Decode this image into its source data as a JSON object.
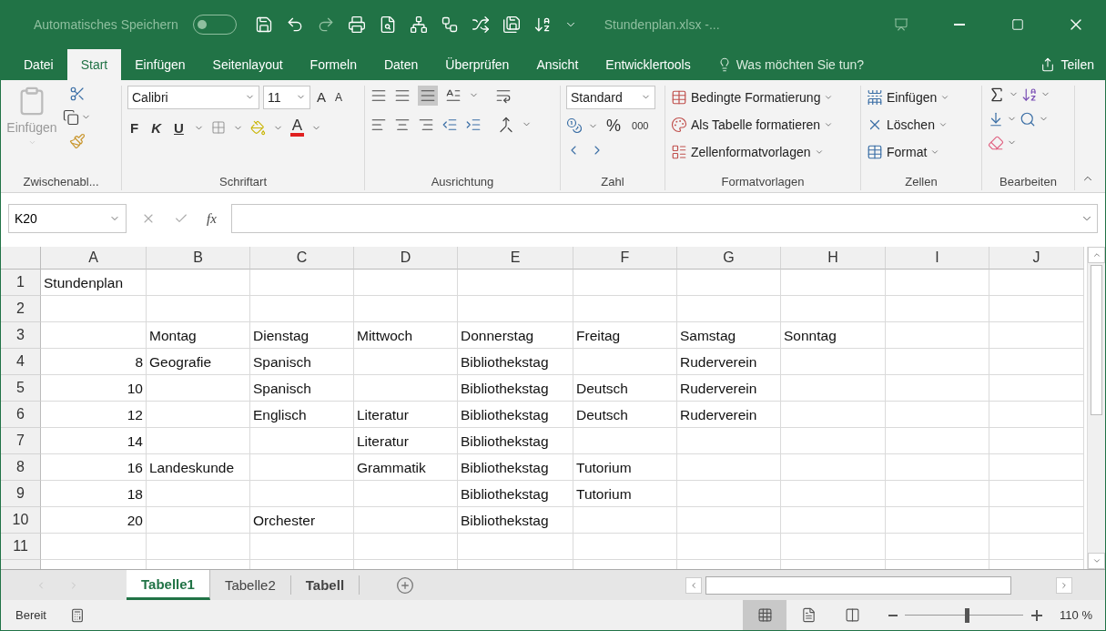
{
  "title_bar": {
    "autosave_label": "Automatisches Speichern",
    "autosave_on": false,
    "file_title": "Stundenplan.xlsx  -..."
  },
  "ribbon_tabs": [
    {
      "label": "Datei",
      "selected": false
    },
    {
      "label": "Start",
      "selected": true
    },
    {
      "label": "Einfügen",
      "selected": false
    },
    {
      "label": "Seitenlayout",
      "selected": false
    },
    {
      "label": "Formeln",
      "selected": false
    },
    {
      "label": "Daten",
      "selected": false
    },
    {
      "label": "Überprüfen",
      "selected": false
    },
    {
      "label": "Ansicht",
      "selected": false
    },
    {
      "label": "Entwicklertools",
      "selected": false
    }
  ],
  "tell_me": "Was möchten Sie tun?",
  "share": "Teilen",
  "ribbon": {
    "clipboard": {
      "paste": "Einfügen",
      "label": "Zwischenabl..."
    },
    "font": {
      "name": "Calibri",
      "size": "11",
      "bold": "F",
      "italic": "K",
      "underline": "U",
      "grow": "A",
      "shrink": "A",
      "color_letter": "A",
      "label": "Schriftart"
    },
    "alignment": {
      "label": "Ausrichtung"
    },
    "number": {
      "format": "Standard",
      "percent": "%",
      "thousands": "000",
      "label": "Zahl"
    },
    "styles": {
      "items": [
        "Bedingte Formatierung",
        "Als Tabelle formatieren",
        "Zellenformatvorlagen"
      ],
      "label": "Formatvorlagen"
    },
    "cells": {
      "items": [
        "Einfügen",
        "Löschen",
        "Format"
      ],
      "label": "Zellen"
    },
    "editing": {
      "label": "Bearbeiten"
    }
  },
  "formula_bar": {
    "name_box": "K20",
    "function_label": "fx"
  },
  "columns": [
    "A",
    "B",
    "C",
    "D",
    "E",
    "F",
    "G",
    "H",
    "I",
    "J"
  ],
  "rows": [
    {
      "number": "1",
      "cells": [
        {
          "text": "Stundenplan",
          "kind": "text"
        },
        null,
        null,
        null,
        null,
        null,
        null,
        null,
        null,
        null
      ]
    },
    {
      "number": "2",
      "cells": [
        null,
        null,
        null,
        null,
        null,
        null,
        null,
        null,
        null,
        null
      ]
    },
    {
      "number": "3",
      "cells": [
        null,
        {
          "text": "Montag",
          "kind": "text"
        },
        {
          "text": "Dienstag",
          "kind": "text"
        },
        {
          "text": "Mittwoch",
          "kind": "text"
        },
        {
          "text": "Donnerstag",
          "kind": "text"
        },
        {
          "text": "Freitag",
          "kind": "text"
        },
        {
          "text": "Samstag",
          "kind": "text"
        },
        {
          "text": "Sonntag",
          "kind": "text"
        },
        null,
        null
      ]
    },
    {
      "number": "4",
      "cells": [
        {
          "text": "8",
          "kind": "number"
        },
        {
          "text": "Geografie",
          "kind": "text"
        },
        {
          "text": "Spanisch",
          "kind": "text"
        },
        null,
        {
          "text": "Bibliothekstag",
          "kind": "text"
        },
        null,
        {
          "text": "Ruderverein",
          "kind": "text"
        },
        null,
        null,
        null
      ]
    },
    {
      "number": "5",
      "cells": [
        {
          "text": "10",
          "kind": "number"
        },
        null,
        {
          "text": "Spanisch",
          "kind": "text"
        },
        null,
        {
          "text": "Bibliothekstag",
          "kind": "text"
        },
        {
          "text": "Deutsch",
          "kind": "text"
        },
        {
          "text": "Ruderverein",
          "kind": "text"
        },
        null,
        null,
        null
      ]
    },
    {
      "number": "6",
      "cells": [
        {
          "text": "12",
          "kind": "number"
        },
        null,
        {
          "text": "Englisch",
          "kind": "text"
        },
        {
          "text": "Literatur",
          "kind": "text"
        },
        {
          "text": "Bibliothekstag",
          "kind": "text"
        },
        {
          "text": "Deutsch",
          "kind": "text"
        },
        {
          "text": "Ruderverein",
          "kind": "text"
        },
        null,
        null,
        null
      ]
    },
    {
      "number": "7",
      "cells": [
        {
          "text": "14",
          "kind": "number"
        },
        null,
        null,
        {
          "text": "Literatur",
          "kind": "text"
        },
        {
          "text": "Bibliothekstag",
          "kind": "text"
        },
        null,
        null,
        null,
        null,
        null
      ]
    },
    {
      "number": "8",
      "cells": [
        {
          "text": "16",
          "kind": "number"
        },
        {
          "text": "Landeskunde",
          "kind": "text"
        },
        null,
        {
          "text": "Grammatik",
          "kind": "text"
        },
        {
          "text": "Bibliothekstag",
          "kind": "text"
        },
        {
          "text": "Tutorium",
          "kind": "text"
        },
        null,
        null,
        null,
        null
      ]
    },
    {
      "number": "9",
      "cells": [
        {
          "text": "18",
          "kind": "number"
        },
        null,
        null,
        null,
        {
          "text": "Bibliothekstag",
          "kind": "text"
        },
        {
          "text": "Tutorium",
          "kind": "text"
        },
        null,
        null,
        null,
        null
      ]
    },
    {
      "number": "10",
      "cells": [
        {
          "text": "20",
          "kind": "number"
        },
        null,
        {
          "text": "Orchester",
          "kind": "text"
        },
        null,
        {
          "text": "Bibliothekstag",
          "kind": "text"
        },
        null,
        null,
        null,
        null,
        null
      ]
    },
    {
      "number": "11",
      "cells": [
        null,
        null,
        null,
        null,
        null,
        null,
        null,
        null,
        null,
        null
      ]
    }
  ],
  "sheet_tabs": [
    {
      "label": "Tabelle1",
      "selected": true,
      "bold": true
    },
    {
      "label": "Tabelle2",
      "selected": false,
      "bold": false
    },
    {
      "label": "Tabell",
      "selected": false,
      "bold": true
    }
  ],
  "status_bar": {
    "status": "Bereit",
    "views": [
      {
        "kind": "normal",
        "selected": true
      },
      {
        "kind": "layout",
        "selected": false
      },
      {
        "kind": "pagebreak",
        "selected": false
      }
    ],
    "zoom": {
      "level": 0.52,
      "reading": "110 %"
    }
  }
}
